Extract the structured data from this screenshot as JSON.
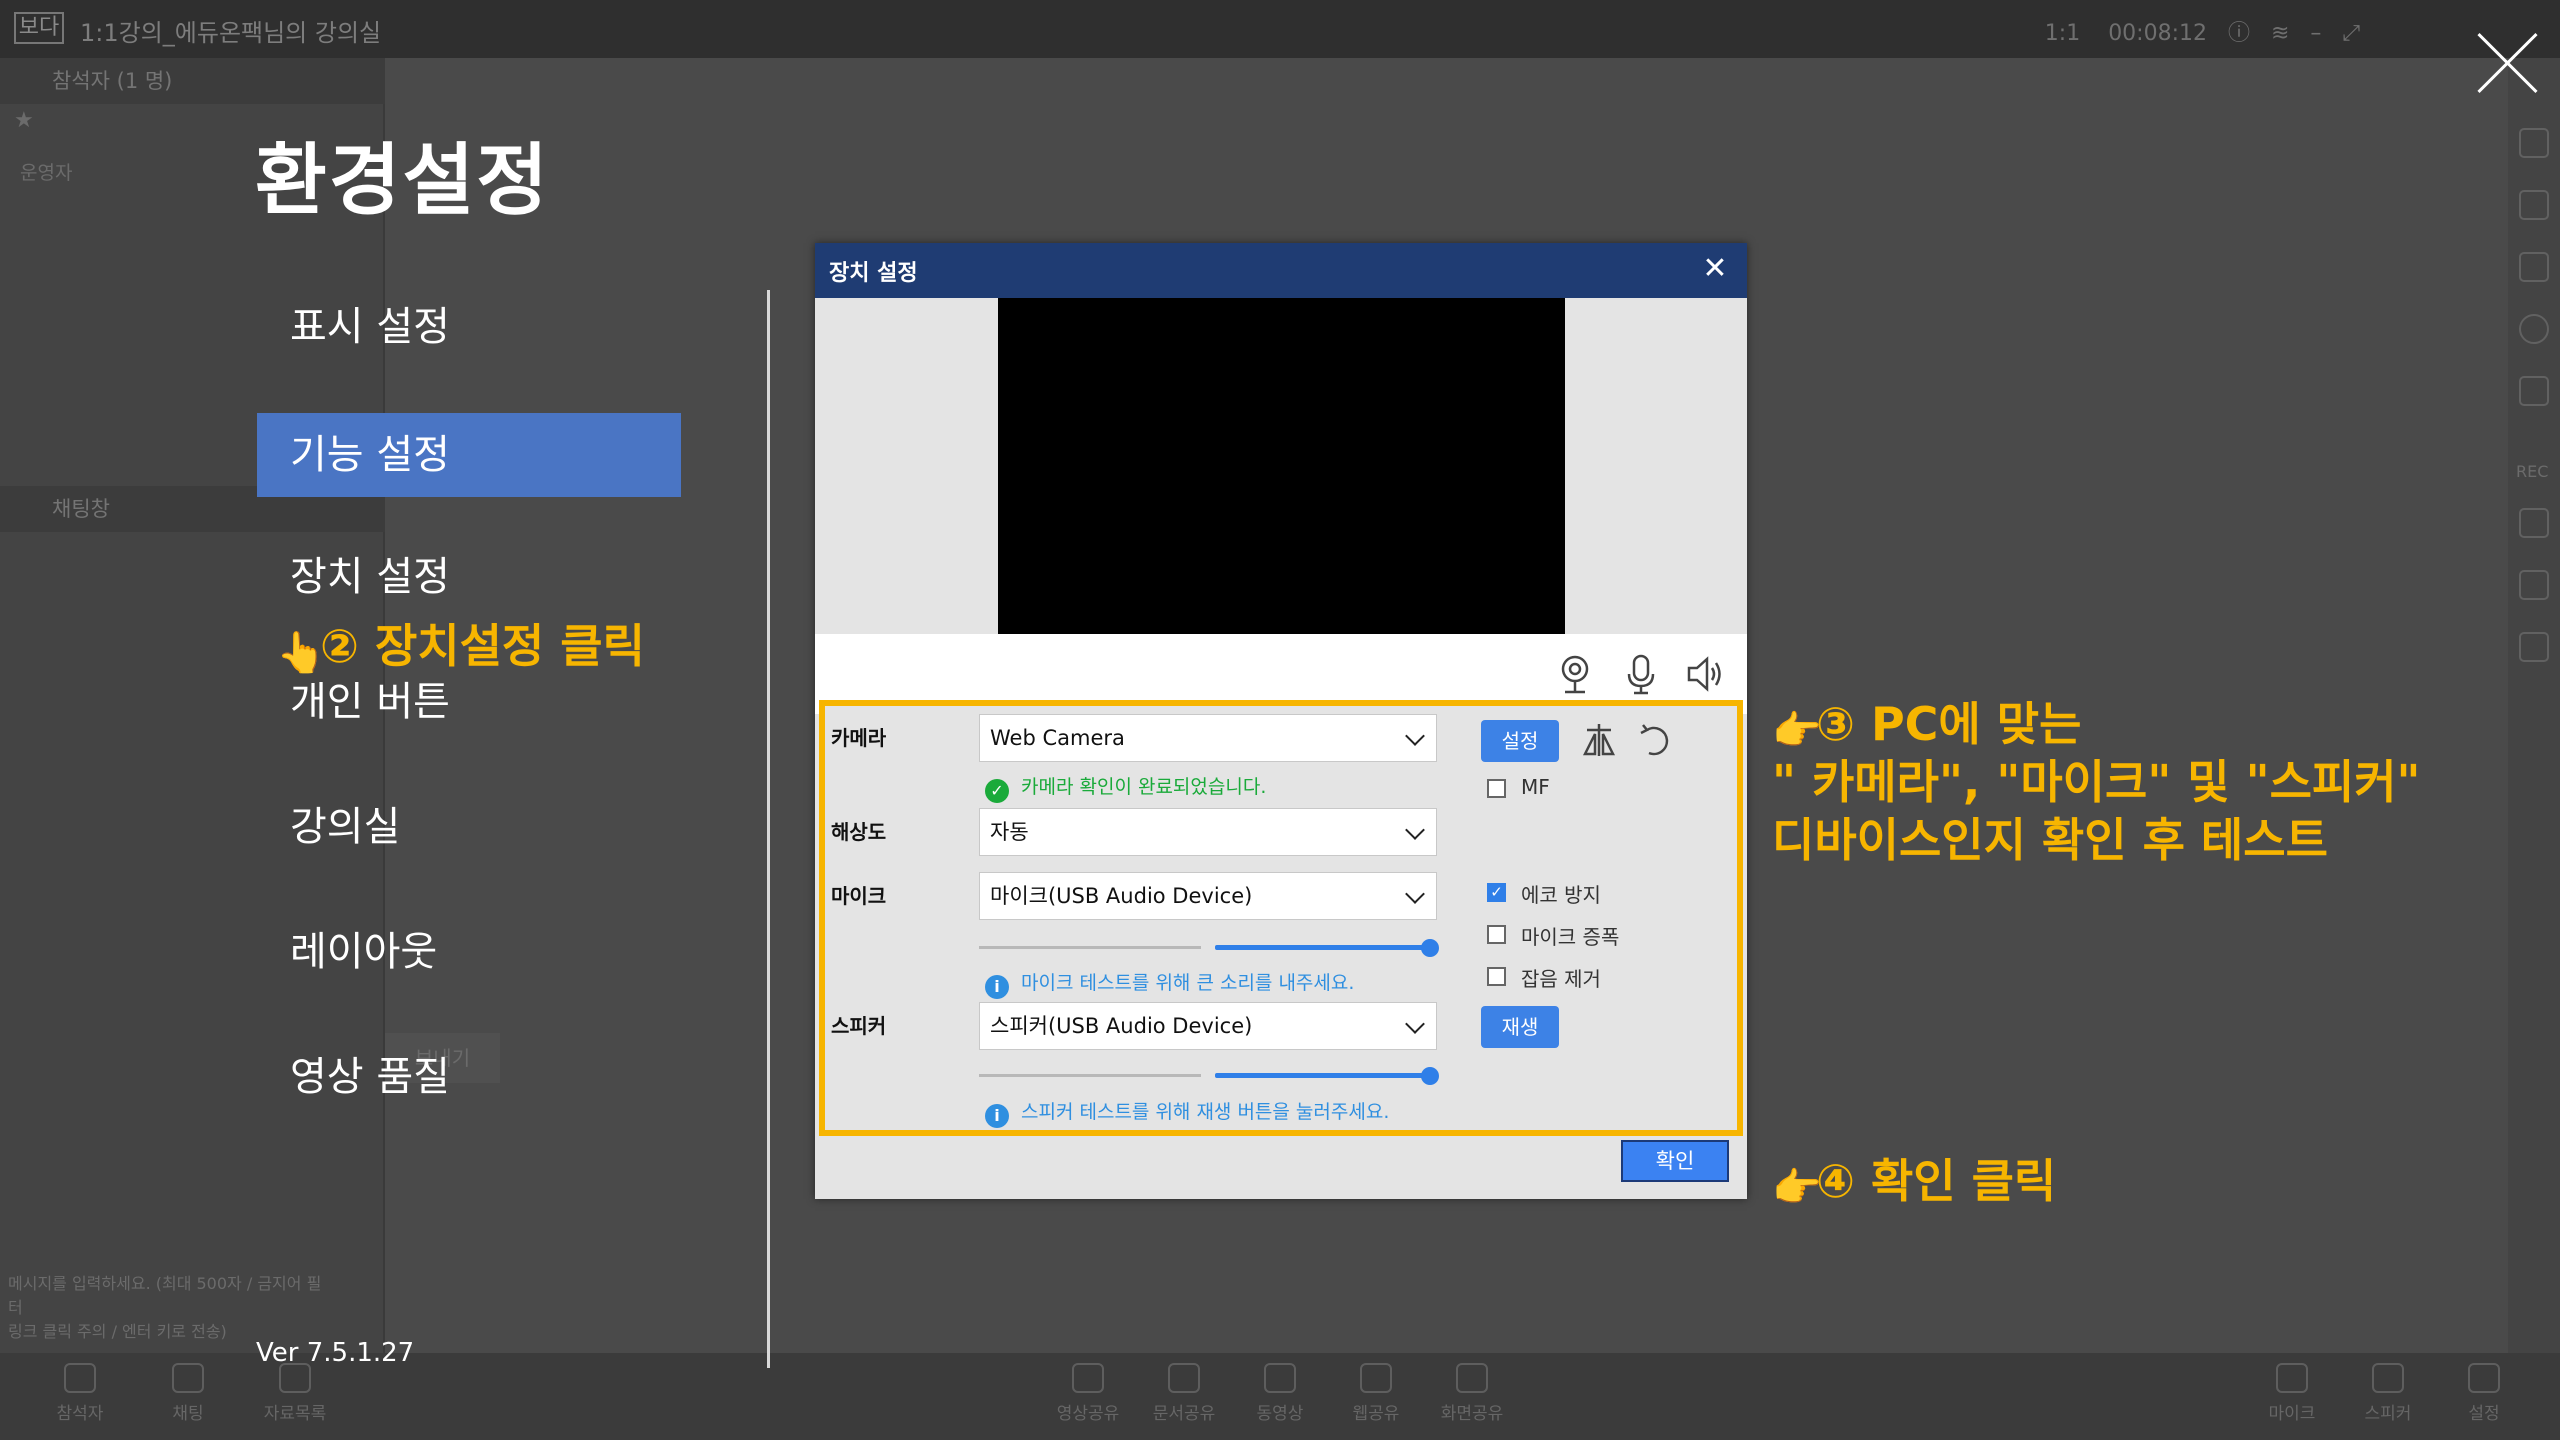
{
  "background": {
    "app_logo": "보다",
    "room_title": "1:1강의_에듀온팩님의 강의실",
    "mode": "1:1",
    "timer": "00:08:12",
    "participants_header": "참석자 (1 명)",
    "participant_role": "운영자",
    "chat_header": "채팅창",
    "chat_placeholder_line1": "메시지를 입력하세요. (최대 500자 / 금지어 필터",
    "chat_placeholder_line2": "링크 클릭 주의 / 엔터 키로 전송)",
    "chat_button": "보내기",
    "rec_label": "REC",
    "bottom_left": [
      "참석자",
      "채팅",
      "자료목록"
    ],
    "bottom_center": [
      "영상공유",
      "문서공유",
      "동영상",
      "웹공유",
      "화면공유"
    ],
    "bottom_right": [
      "마이크",
      "스피커",
      "설정"
    ]
  },
  "settings": {
    "title": "환경설정",
    "menu": [
      {
        "label": "표시 설정",
        "active": false
      },
      {
        "label": "기능 설정",
        "active": true
      },
      {
        "label": "장치 설정",
        "active": false
      },
      {
        "label": "개인 버튼",
        "active": false
      },
      {
        "label": "강의실",
        "active": false
      },
      {
        "label": "레이아웃",
        "active": false
      },
      {
        "label": "영상 품질",
        "active": false
      }
    ],
    "version": "Ver 7.5.1.27"
  },
  "annotations": {
    "step2": "② 장치설정 클릭",
    "step3_line1": "③ PC에 맞는",
    "step3_line2": "\" 카메라\", \"마이크\" 및 \"스피커\"",
    "step3_line3": "디바이스인지 확인 후 테스트",
    "step4": "④ 확인 클릭"
  },
  "dialog": {
    "title": "장치 설정",
    "camera_label": "카메라",
    "camera_value": "Web Camera",
    "camera_status": "카메라 확인이 완료되었습니다.",
    "setup_button": "설정",
    "mf_label": "MF",
    "resolution_label": "해상도",
    "resolution_value": "자동",
    "mic_label": "마이크",
    "mic_value": "마이크(USB Audio Device)",
    "mic_hint": "마이크 테스트를 위해 큰 소리를 내주세요.",
    "mic_volume": 1.0,
    "echo_label": "에코 방지",
    "echo_checked": true,
    "boost_label": "마이크 증폭",
    "boost_checked": false,
    "noise_label": "잡음 제거",
    "noise_checked": false,
    "speaker_label": "스피커",
    "speaker_value": "스피커(USB Audio Device)",
    "play_button": "재생",
    "speaker_hint": "스피커 테스트를 위해 재생 버튼을 눌러주세요.",
    "speaker_volume": 1.0,
    "ok_button": "확인"
  },
  "colors": {
    "accent": "#4a75c4",
    "highlight": "#f7b500",
    "dialog_header": "#1f3c73",
    "success_text": "#1aaa3a",
    "info_text": "#2f8fe0"
  }
}
